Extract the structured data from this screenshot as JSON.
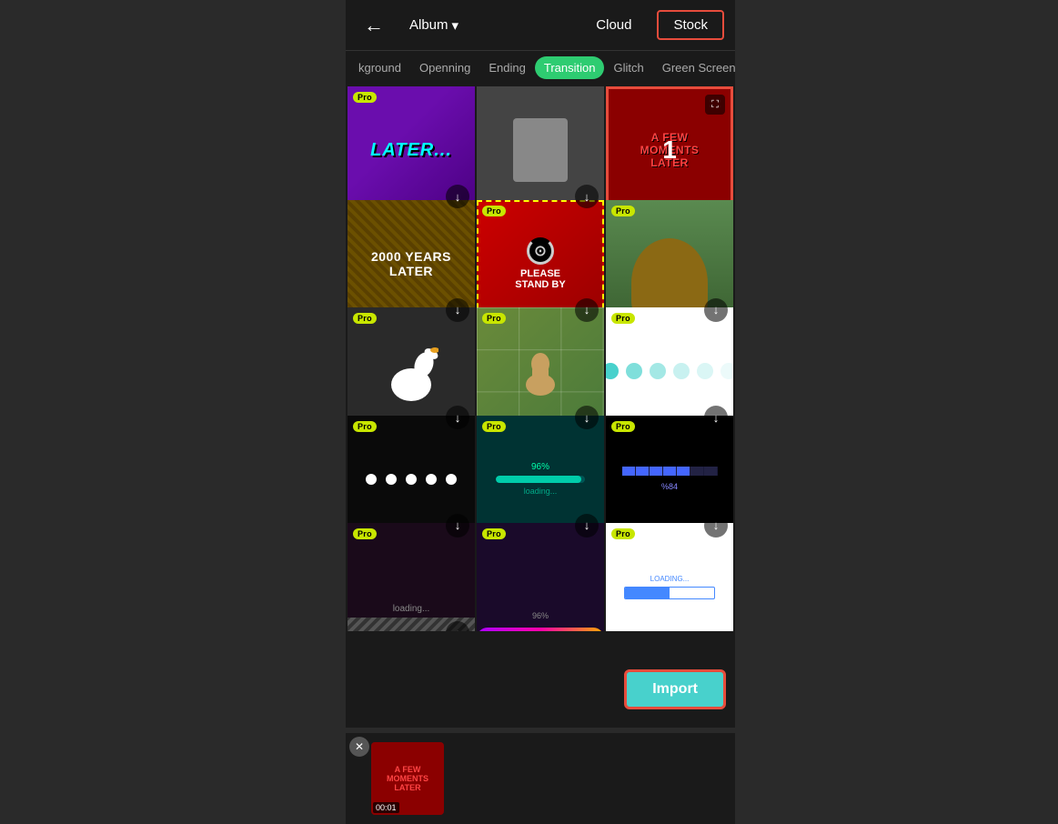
{
  "header": {
    "back_label": "←",
    "album_label": "Album",
    "album_arrow": "▾",
    "cloud_label": "Cloud",
    "stock_label": "Stock"
  },
  "tabs": [
    {
      "id": "background",
      "label": "kground"
    },
    {
      "id": "opening",
      "label": "Openning"
    },
    {
      "id": "ending",
      "label": "Ending"
    },
    {
      "id": "transition",
      "label": "Transition",
      "active": true
    },
    {
      "id": "glitch",
      "label": "Glitch"
    },
    {
      "id": "greenscreen",
      "label": "Green Screen"
    }
  ],
  "grid": {
    "items": [
      {
        "id": 1,
        "pro": true,
        "type": "later",
        "selected": false,
        "download": true,
        "expand": false
      },
      {
        "id": 2,
        "pro": false,
        "type": "running",
        "selected": false,
        "download": true,
        "expand": false
      },
      {
        "id": 3,
        "pro": false,
        "type": "red",
        "selected": true,
        "download": false,
        "expand": true
      },
      {
        "id": 4,
        "pro": false,
        "type": "years2000",
        "selected": false,
        "download": true,
        "expand": false
      },
      {
        "id": 5,
        "pro": true,
        "type": "standin",
        "selected": false,
        "download": true,
        "expand": false
      },
      {
        "id": 6,
        "pro": true,
        "type": "mole",
        "selected": false,
        "download": true,
        "expand": false
      },
      {
        "id": 7,
        "pro": true,
        "type": "goose",
        "selected": false,
        "download": true,
        "expand": false
      },
      {
        "id": 8,
        "pro": true,
        "type": "llama",
        "selected": false,
        "download": true,
        "expand": false
      },
      {
        "id": 9,
        "pro": true,
        "type": "spinner",
        "selected": false,
        "download": true,
        "expand": false
      },
      {
        "id": 10,
        "pro": true,
        "type": "dots_black",
        "selected": false,
        "download": true,
        "expand": false
      },
      {
        "id": 11,
        "pro": true,
        "type": "loading_teal",
        "selected": false,
        "download": true,
        "expand": false
      },
      {
        "id": 12,
        "pro": true,
        "type": "loading_blue",
        "selected": false,
        "download": true,
        "expand": false
      },
      {
        "id": 13,
        "pro": true,
        "type": "loading_text",
        "selected": false,
        "download": true,
        "expand": false
      },
      {
        "id": 14,
        "pro": true,
        "type": "purple_bar",
        "selected": false,
        "download": false,
        "expand": false
      },
      {
        "id": 15,
        "pro": true,
        "type": "loading_white",
        "selected": false,
        "download": false,
        "expand": false
      }
    ]
  },
  "import_btn": "Import",
  "close_btn": "✕",
  "preview": {
    "time": "00:01"
  },
  "pro_label": "Pro",
  "download_icon": "↓",
  "expand_icon": "⛶",
  "num_badge": "1"
}
